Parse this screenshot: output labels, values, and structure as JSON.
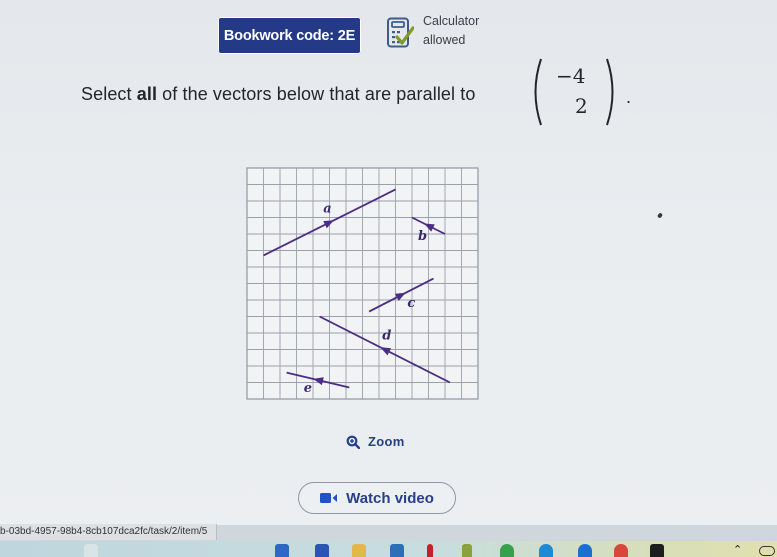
{
  "header": {
    "bookwork_code": "Bookwork code: 2E",
    "calculator_line1": "Calculator",
    "calculator_line2": "allowed",
    "calculator_icon": "calculator-check-icon"
  },
  "question": {
    "prefix": "Select ",
    "bold": "all",
    "suffix": " of the vectors below that are parallel to",
    "target_vector": {
      "top": "−4",
      "bottom": "2"
    },
    "period": "."
  },
  "diagram": {
    "grid": {
      "columns": 14,
      "rows": 14
    },
    "line_color": "#4b2d83",
    "vectors": [
      {
        "label": "a",
        "from": [
          1,
          5.3
        ],
        "to": [
          9,
          1.3
        ],
        "arrow": "forward"
      },
      {
        "label": "b",
        "from": [
          12,
          4
        ],
        "to": [
          10,
          3
        ],
        "arrow": "forward"
      },
      {
        "label": "c",
        "from": [
          7.4,
          8.7
        ],
        "to": [
          11.3,
          6.7
        ],
        "arrow": "forward"
      },
      {
        "label": "d",
        "from": [
          12.3,
          13
        ],
        "to": [
          4.4,
          9
        ],
        "arrow": "forward"
      },
      {
        "label": "e",
        "from": [
          6.2,
          13.3
        ],
        "to": [
          2.4,
          12.4
        ],
        "arrow": "forward"
      }
    ]
  },
  "actions": {
    "zoom_label": "Zoom",
    "watch_video_label": "Watch video"
  },
  "browser": {
    "status_url": "b-03bd-4957-98b4-8cb107dca2fc/task/2/item/5"
  },
  "taskbar": {
    "icons": [
      "file-explorer-icon",
      "store-icon",
      "mail-icon",
      "folder-icon",
      "app-icon",
      "netflix-icon",
      "spotify-icon",
      "vector-app-icon",
      "edge-icon",
      "onedrive-icon",
      "chrome-icon",
      "capcut-icon",
      "chevron-up-icon",
      "cloud-icon"
    ]
  }
}
